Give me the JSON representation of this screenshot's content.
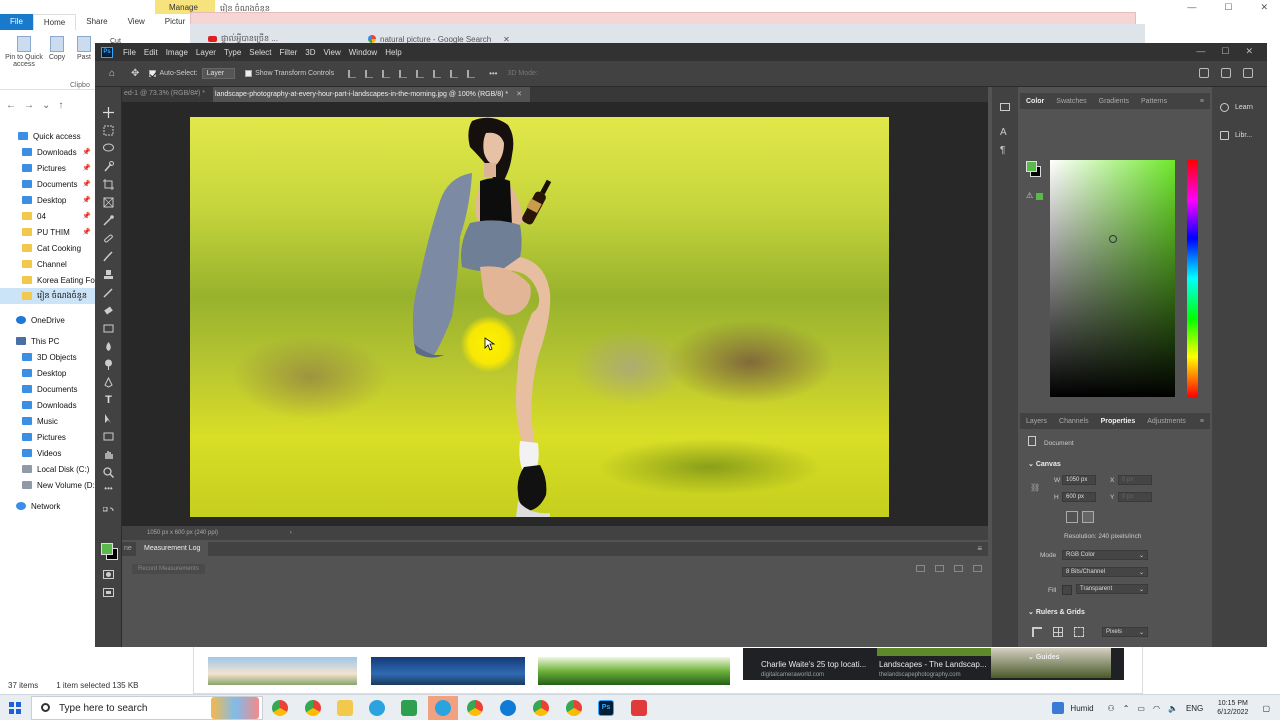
{
  "explorer": {
    "manage_label": "Manage",
    "path_fragment": "រៀន ចំណងចំនួន",
    "ribbon_tabs": [
      "File",
      "Home",
      "Share",
      "View",
      "Pictur"
    ],
    "ribbon_buttons": [
      "Pin to Quick access",
      "Copy",
      "Past"
    ],
    "cut_label": "Cut",
    "clipboard_label": "Clipbo",
    "quick_access": "Quick access",
    "items": [
      {
        "label": "Downloads",
        "icon": "download-icon",
        "pinned": true
      },
      {
        "label": "Pictures",
        "icon": "pictures-icon",
        "pinned": true
      },
      {
        "label": "Documents",
        "icon": "documents-icon",
        "pinned": true
      },
      {
        "label": "Desktop",
        "icon": "desktop-icon",
        "pinned": true
      },
      {
        "label": "04",
        "icon": "folder-icon",
        "pinned": true
      },
      {
        "label": "PU THIM",
        "icon": "folder-icon",
        "pinned": true
      },
      {
        "label": "Cat Cooking",
        "icon": "folder-icon",
        "pinned": false
      },
      {
        "label": "Channel",
        "icon": "folder-icon",
        "pinned": false
      },
      {
        "label": "Korea Eating Foo",
        "icon": "folder-icon",
        "pinned": false
      },
      {
        "label": "រៀន ចំណងចំនួន",
        "icon": "folder-icon",
        "pinned": false
      }
    ],
    "onedrive": "OneDrive",
    "this_pc": "This PC",
    "pc_items": [
      {
        "label": "3D Objects"
      },
      {
        "label": "Desktop"
      },
      {
        "label": "Documents"
      },
      {
        "label": "Downloads"
      },
      {
        "label": "Music"
      },
      {
        "label": "Pictures"
      },
      {
        "label": "Videos"
      },
      {
        "label": "Local Disk (C:)"
      },
      {
        "label": "New Volume (D:)"
      }
    ],
    "network": "Network",
    "status_items": "37 items",
    "status_selected": "1 item selected  135 KB"
  },
  "chrome": {
    "tab1": "ផ្ទាល់អ្វីបានច្រើន ...",
    "tab2": "natural picture - Google Search"
  },
  "google_card": {
    "title1": "Charlie Waite's 25 top locati...",
    "source1": "digitalcameraworld.com",
    "title2": "Landscapes - The Landscap...",
    "source2": "thelandscapephotography.com"
  },
  "photoshop": {
    "menus": [
      "File",
      "Edit",
      "Image",
      "Layer",
      "Type",
      "Select",
      "Filter",
      "3D",
      "View",
      "Window",
      "Help"
    ],
    "options": {
      "auto_select_label": "Auto-Select:",
      "auto_select_value": "Layer",
      "transform_label": "Show Transform Controls",
      "mode3d_label": "3D Mode:"
    },
    "doc_tabs": [
      {
        "label": "ed-1 @ 73.3% (RGB/8#) *",
        "active": false
      },
      {
        "label": "landscape-photography-at-every-hour-part-i-landscapes-in-the-morning.jpg @ 100% (RGB/8) *",
        "active": true
      }
    ],
    "status_bar": "1050 px x 600 px (240 ppi)",
    "measurement_tab": "Measurement Log",
    "measurement_tab_cut": "ne",
    "record_button": "Record Measurements",
    "color_tabs": [
      "Color",
      "Swatches",
      "Gradients",
      "Patterns"
    ],
    "panel_tabs": [
      "Layers",
      "Channels",
      "Properties",
      "Adjustments"
    ],
    "properties": {
      "document_label": "Document",
      "canvas_head": "Canvas",
      "w_label": "W",
      "w_value": "1050 px",
      "h_label": "H",
      "h_value": "600 px",
      "x_label": "X",
      "x_placeholder": "0 px",
      "y_label": "Y",
      "y_placeholder": "0 px",
      "resolution": "Resolution: 240 pixels/inch",
      "mode_label": "Mode",
      "mode_value": "RGB Color",
      "bits_value": "8 Bits/Channel",
      "fill_label": "Fill",
      "fill_value": "Transparent",
      "rulers_head": "Rulers & Grids",
      "units_value": "Pixels",
      "guides_head": "Guides"
    },
    "learn_label": "Learn",
    "libraries_label": "Libr...",
    "fg_color": "#5bb84a",
    "bg_color": "#000000"
  },
  "taskbar": {
    "search_placeholder": "Type here to search",
    "weather": "Humid",
    "lang": "ENG",
    "time": "10:15 PM",
    "date": "6/12/2022"
  }
}
